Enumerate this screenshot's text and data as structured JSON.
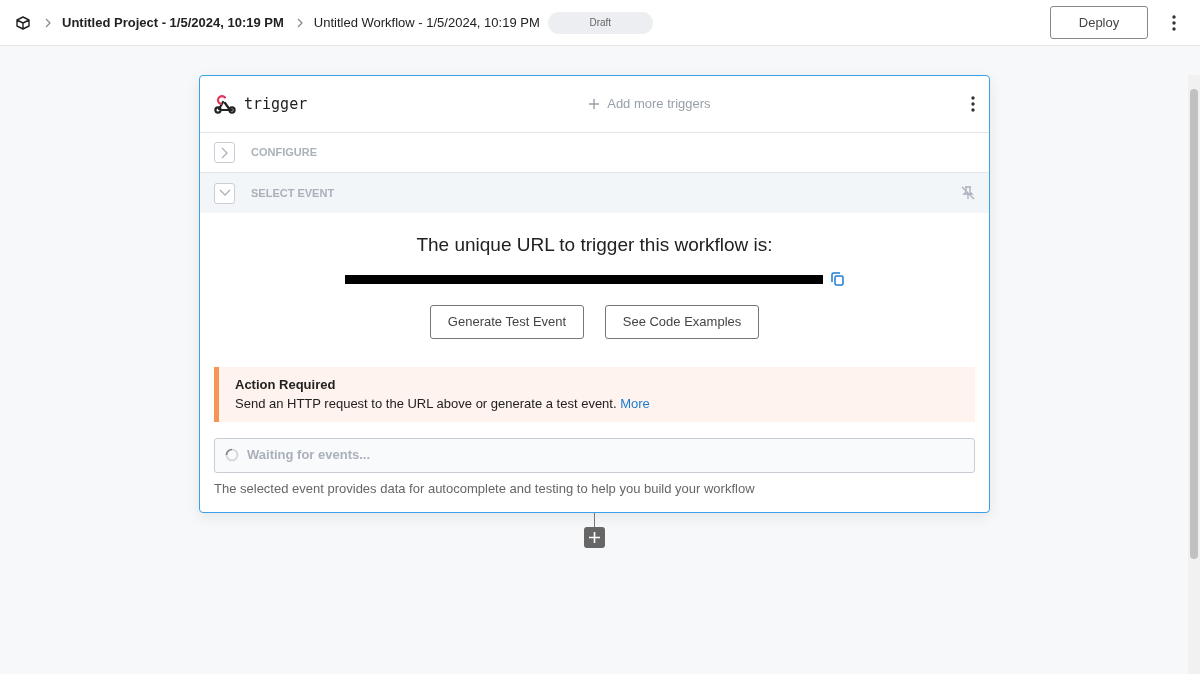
{
  "breadcrumb": [
    {
      "label": "Untitled Project - 1/5/2024, 10:19 PM",
      "current": false
    },
    {
      "label": "Untitled Workflow - 1/5/2024, 10:19 PM",
      "current": true
    }
  ],
  "status_badge": "Draft",
  "deploy_button": "Deploy",
  "trigger": {
    "title": "trigger",
    "add_more": "Add more triggers",
    "sections": [
      {
        "label": "CONFIGURE",
        "expanded": false
      },
      {
        "label": "SELECT EVENT",
        "expanded": true
      }
    ],
    "heading": "The unique URL to trigger this workflow is:",
    "url": {
      "redacted": true
    },
    "buttons": [
      "Generate Test Event",
      "See Code Examples"
    ],
    "alert": {
      "title": "Action Required",
      "text": "Send an HTTP request to the URL above or generate a test event.",
      "link": "More"
    },
    "waiting": "Waiting for events...",
    "help": "The selected event provides data for autocomplete and testing to help you build your workflow"
  }
}
